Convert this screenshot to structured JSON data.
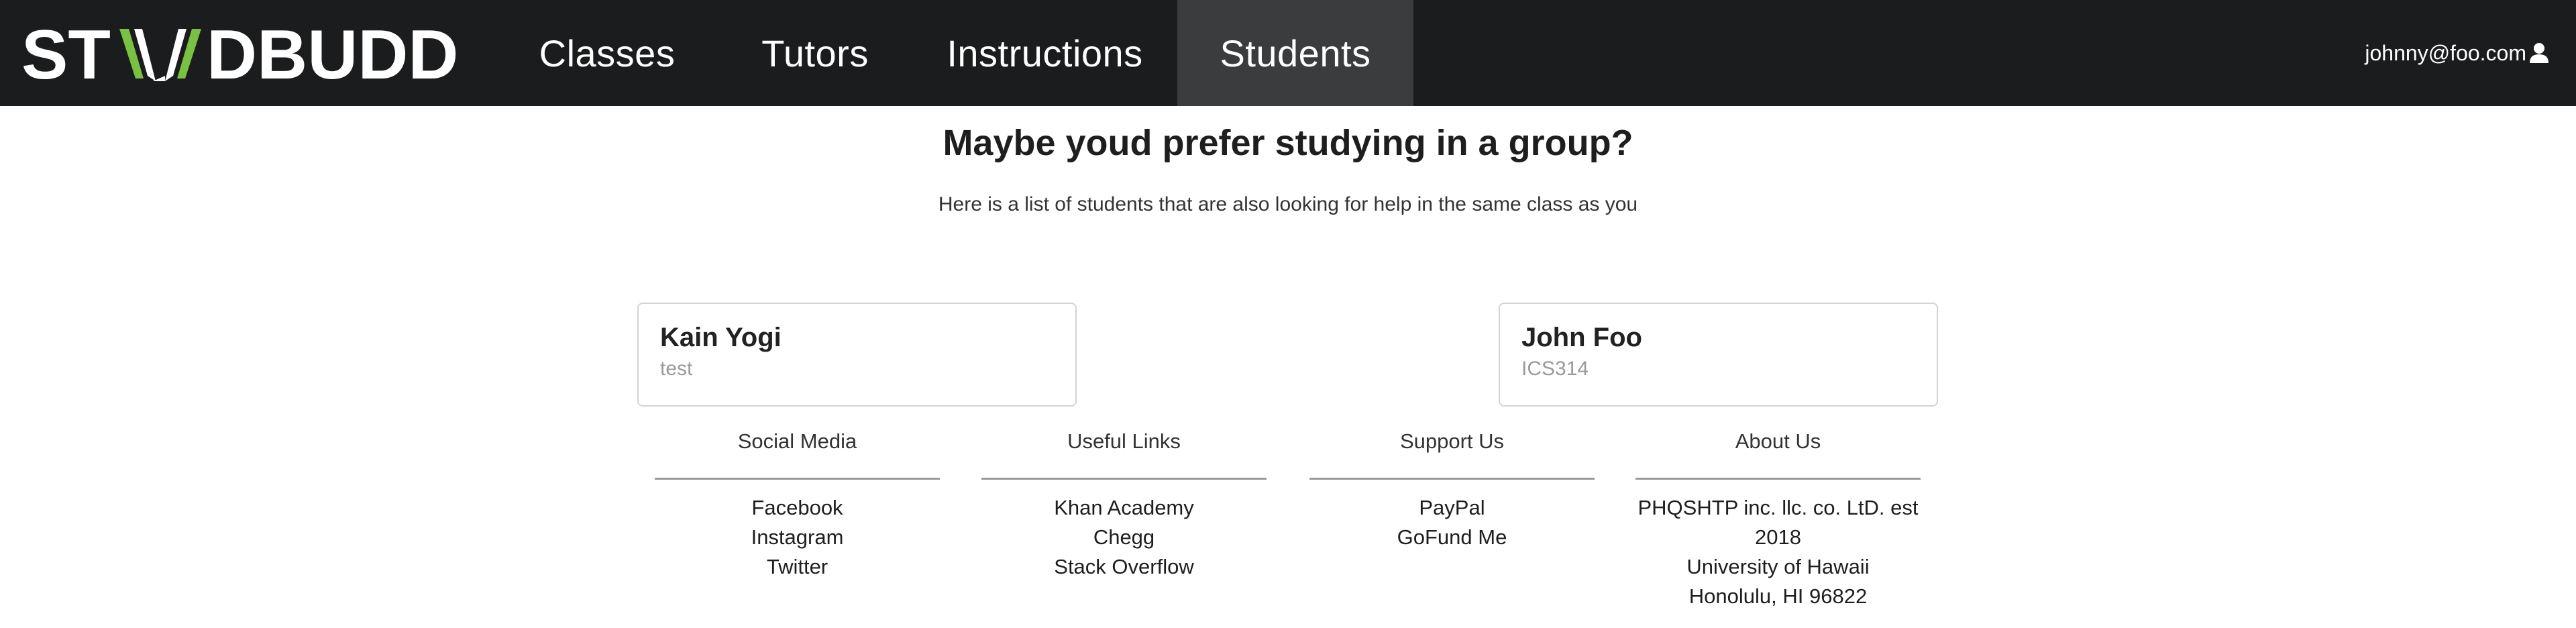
{
  "brand": {
    "logo_text": "STUDBUDD"
  },
  "nav": {
    "items": [
      {
        "label": "Classes"
      },
      {
        "label": "Tutors"
      },
      {
        "label": "Instructions"
      },
      {
        "label": "Students",
        "active": true
      }
    ]
  },
  "user": {
    "email": "johnny@foo.com",
    "icon": "user-icon"
  },
  "main": {
    "title": "Maybe youd prefer studying in a group?",
    "subtitle": "Here is a list of students that are also looking for help in the same class as you"
  },
  "students": [
    {
      "name": "Kain Yogi",
      "class": "test"
    },
    {
      "name": "John Foo",
      "class": "ICS314"
    }
  ],
  "footer": {
    "columns": [
      {
        "heading": "Social Media",
        "items": [
          "Facebook",
          "Instagram",
          "Twitter"
        ]
      },
      {
        "heading": "Useful Links",
        "items": [
          "Khan Academy",
          "Chegg",
          "Stack Overflow"
        ]
      },
      {
        "heading": "Support Us",
        "items": [
          "PayPal",
          "GoFund Me"
        ]
      },
      {
        "heading": "About Us",
        "items": [
          "PHQSHTP inc. llc. co. LtD. est 2018",
          "University of Hawaii",
          "Honolulu, HI 96822"
        ]
      }
    ]
  },
  "colors": {
    "navbar_bg": "#1b1c1d",
    "nav_active_bg": "#3b3c3d",
    "logo_accent": "#7ac143"
  }
}
